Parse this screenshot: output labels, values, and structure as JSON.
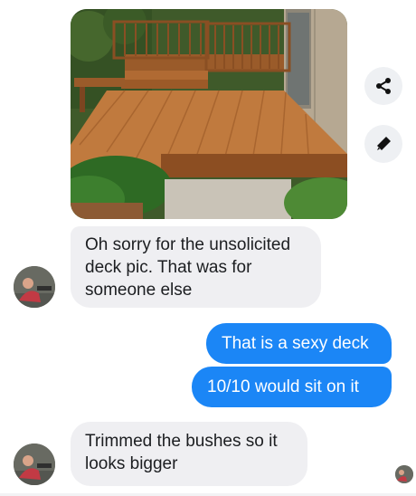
{
  "conversation": {
    "messages": [
      {
        "sender": "contact",
        "type": "photo",
        "alt": "Wooden backyard deck with railing and steps"
      },
      {
        "sender": "contact",
        "type": "text",
        "lines": [
          "Oh sorry for the unsolicited",
          "deck pic. That was for",
          "someone else"
        ]
      },
      {
        "sender": "me",
        "type": "text",
        "text": "That is a sexy deck"
      },
      {
        "sender": "me",
        "type": "text",
        "text": "10/10 would sit on it"
      },
      {
        "sender": "contact",
        "type": "text",
        "lines": [
          "Trimmed the bushes so it",
          "looks bigger"
        ]
      }
    ]
  },
  "actions": {
    "share_icon": "share-icon",
    "edit_icon": "pencil-icon"
  },
  "colors": {
    "outgoing_bubble": "#1b86f6",
    "incoming_bubble": "#efeff2",
    "action_button_bg": "#eef0f3"
  }
}
